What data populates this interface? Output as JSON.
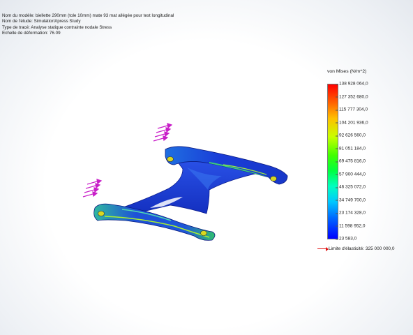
{
  "info": {
    "model": "Nom du modèle: biellette 290mm (tole 10mm) mate 93 mat allégée pour test longitudinal",
    "study": "Nom de l'étude: SimulationXpress Study",
    "plot": "Type de tracé: Analyse statique contrainte nodale Stress",
    "scale": "Echelle de déformation: 76.09"
  },
  "legend": {
    "title": "von Mises (N/m^2)",
    "ticks": [
      "138 928 064,0",
      "127 352 680,0",
      "115 777 304,0",
      "104 201 936,0",
      "92 626 560,0",
      "81 051 184,0",
      "69 475 816,0",
      "57 900 444,0",
      "46 325 072,0",
      "34 749 700,0",
      "23 174 328,0",
      "11 598 952,0",
      "23 583,0"
    ],
    "yield_limit": "Limite d'élasticité: 325 000 000,0",
    "colors": {
      "max": "#ff0000",
      "min": "#0000ff",
      "yield_arrow": "#e01010"
    }
  },
  "loads": {
    "color": "#c81ec8",
    "icon": "force-arrows-icon"
  }
}
